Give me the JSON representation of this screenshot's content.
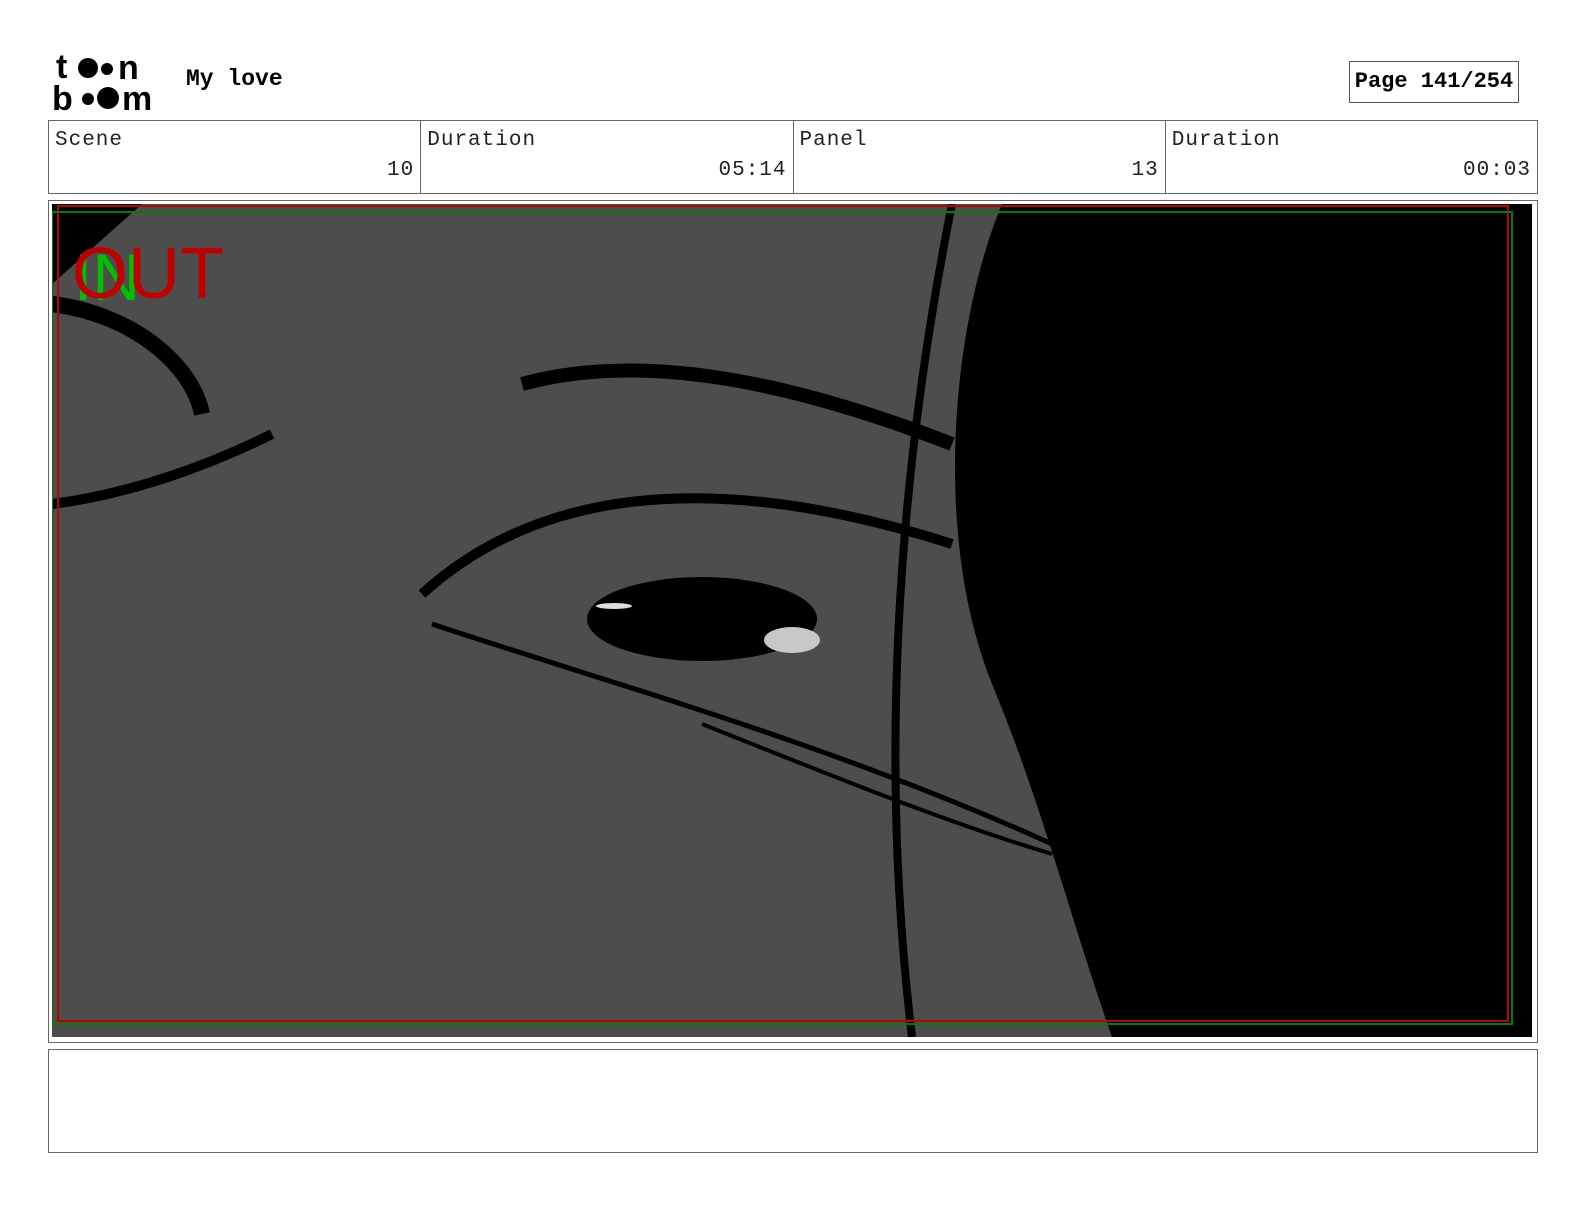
{
  "header": {
    "logo_text": "toon boom",
    "title": "My love",
    "page_label": "Page 141/254"
  },
  "info": [
    {
      "label": "Scene",
      "value": "10"
    },
    {
      "label": "Duration",
      "value": "05:14"
    },
    {
      "label": "Panel",
      "value": "13"
    },
    {
      "label": "Duration",
      "value": "00:03"
    }
  ],
  "panel": {
    "in_marker": "IN",
    "out_marker": "OUT",
    "colors": {
      "background": "#4d4d4d",
      "in": "#00c000",
      "out": "#c00000",
      "safe_frame": "#c00000",
      "action_frame": "#008000"
    }
  },
  "notes": {
    "text": ""
  }
}
